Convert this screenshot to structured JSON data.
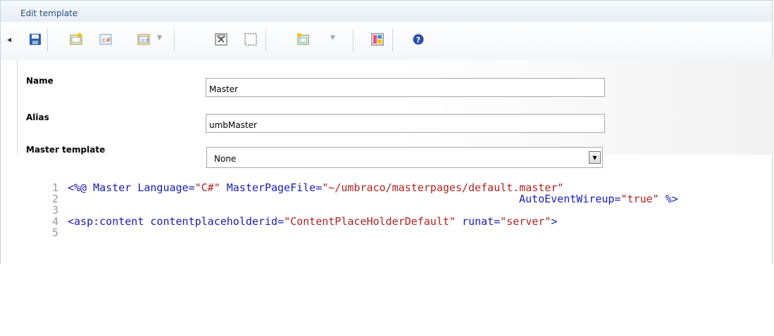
{
  "panel": {
    "title": "Edit template"
  },
  "toolbar": {
    "buttons": [
      {
        "icon": "save-icon"
      },
      {
        "icon": "insert-field-icon"
      },
      {
        "icon": "insert-inline-code-icon"
      },
      {
        "icon": "insert-macro-icon"
      },
      {
        "icon": "insert-placeholder-icon"
      },
      {
        "icon": "insert-content-area-icon"
      },
      {
        "icon": "insert-snippet-icon"
      },
      {
        "icon": "templates-icon"
      },
      {
        "icon": "help-icon"
      }
    ]
  },
  "form": {
    "name_label": "Name",
    "name_value": "Master",
    "alias_label": "Alias",
    "alias_value": "umbMaster",
    "master_label": "Master template",
    "master_value": "None"
  },
  "code": {
    "lines": [
      {
        "num": "1",
        "text": "<%@ Master Language=\"C#\" MasterPageFile=\"~/umbraco/masterpages/default.master\""
      },
      {
        "num": "2",
        "text": "AutoEventWireup=\"true\" %>"
      },
      {
        "num": "3",
        "text": ""
      },
      {
        "num": "4",
        "text": "<asp:content contentplaceholderid=\"ContentPlaceHolderDefault\" runat=\"server\">"
      },
      {
        "num": "5",
        "text": ""
      }
    ]
  },
  "colors": {
    "title": "#1f4f7a",
    "keyword": "#1a1ab8",
    "string": "#b22222",
    "border": "#c6d3e3"
  }
}
